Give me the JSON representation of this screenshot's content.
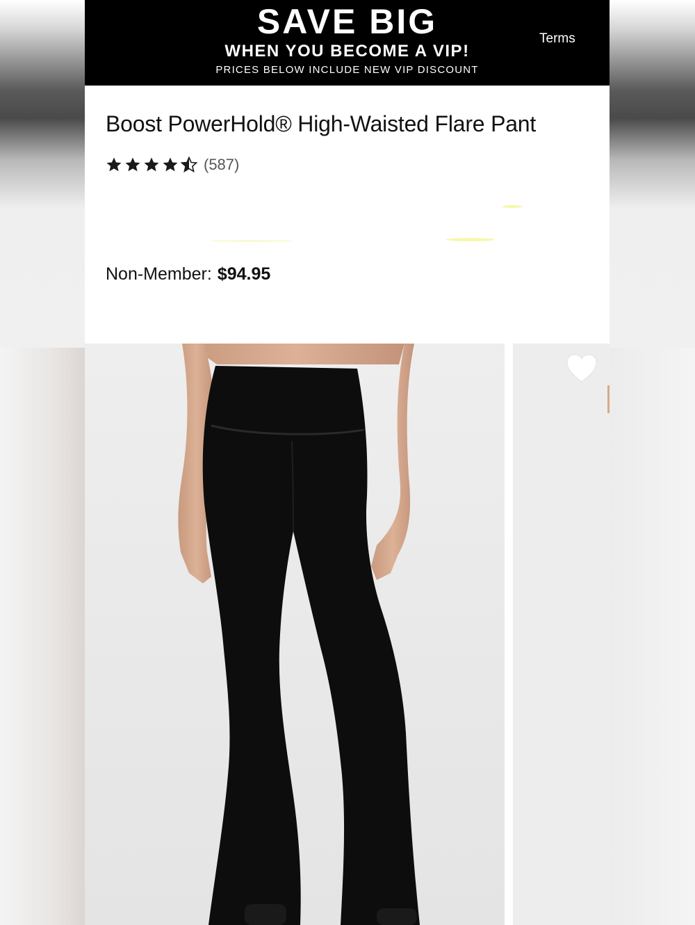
{
  "banner": {
    "headline": "SAVE BIG",
    "subheadline": "WHEN YOU BECOME A VIP!",
    "note": "PRICES BELOW INCLUDE NEW VIP DISCOUNT",
    "terms_label": "Terms"
  },
  "product": {
    "title": "Boost PowerHold® High-Waisted Flare Pant",
    "rating": 4.5,
    "rating_max": 5,
    "review_count": "(587)",
    "price_label": "Non-Member:",
    "price": "$94.95"
  },
  "gallery": {
    "favorite_icon": "heart-icon"
  },
  "colors": {
    "banner_bg": "#000000",
    "banner_text": "#ffffff",
    "star": "#1a1a1a",
    "image_bg": "#ebebeb"
  }
}
